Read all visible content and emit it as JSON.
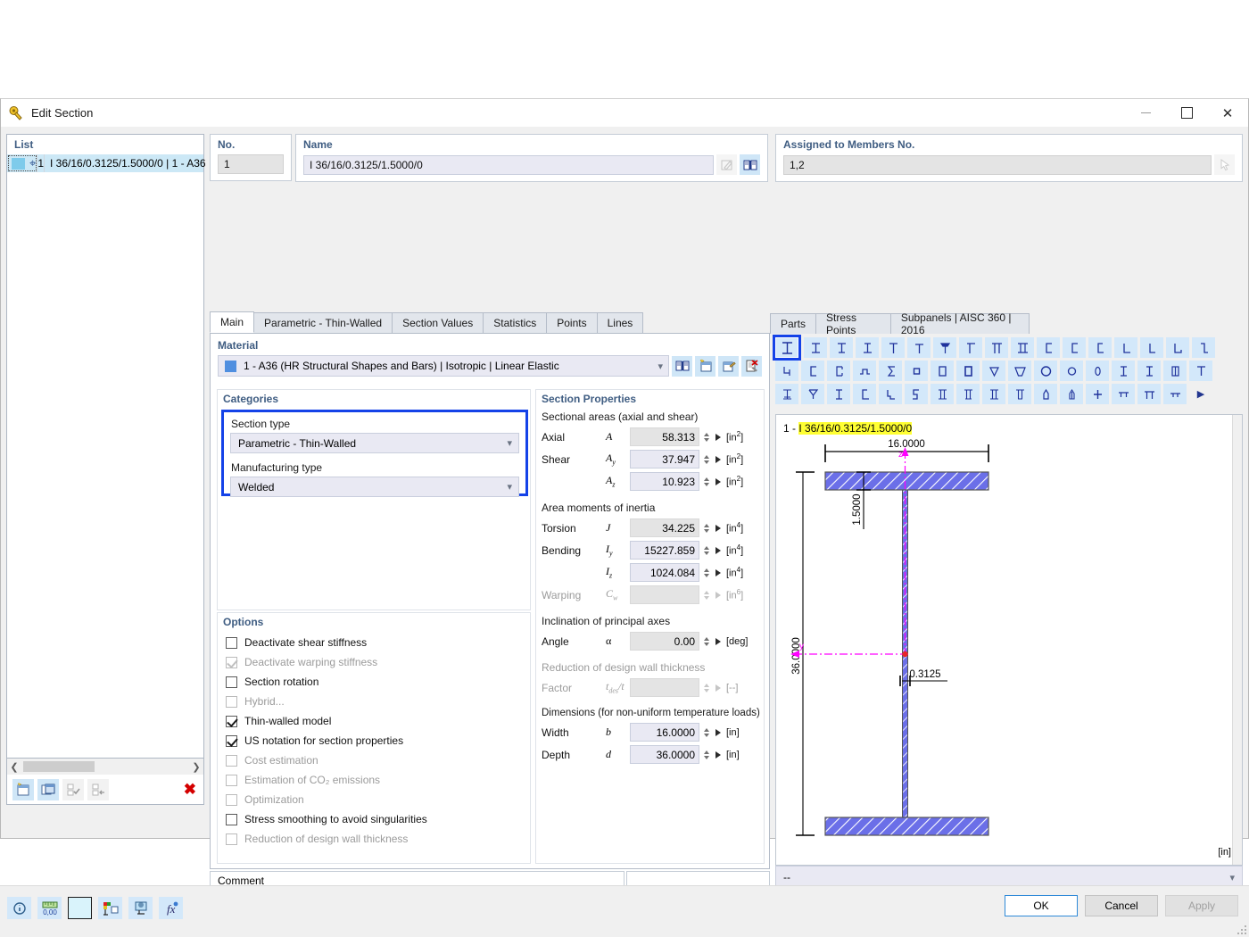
{
  "window": {
    "title": "Edit Section",
    "minimize": "—",
    "maximize": "□",
    "close": "✕"
  },
  "list": {
    "header": "List",
    "rows": [
      {
        "num": "1",
        "label": "I 36/16/0.3125/1.5000/0 | 1 - A36"
      }
    ]
  },
  "no_field": {
    "label": "No.",
    "value": "1"
  },
  "name_field": {
    "label": "Name",
    "value": "I 36/16/0.3125/1.5000/0"
  },
  "assigned": {
    "label": "Assigned to Members No.",
    "value": "1,2"
  },
  "tabs": [
    {
      "label": "Main",
      "active": true
    },
    {
      "label": "Parametric - Thin-Walled",
      "active": false
    },
    {
      "label": "Section Values",
      "active": false
    },
    {
      "label": "Statistics",
      "active": false
    },
    {
      "label": "Points",
      "active": false
    },
    {
      "label": "Lines",
      "active": false
    },
    {
      "label": "Parts",
      "active": false
    },
    {
      "label": "Stress Points",
      "active": false
    },
    {
      "label": "Subpanels | AISC 360 | 2016",
      "active": false
    }
  ],
  "material": {
    "label": "Material",
    "value": "1 - A36 (HR Structural Shapes and Bars) | Isotropic | Linear Elastic",
    "swatch_color": "#4f8fe0"
  },
  "categories": {
    "label": "Categories",
    "section_type_label": "Section type",
    "section_type_value": "Parametric - Thin-Walled",
    "manufacturing_type_label": "Manufacturing type",
    "manufacturing_type_value": "Welded",
    "highlight_color": "#1442e8"
  },
  "options": {
    "label": "Options",
    "items": [
      {
        "label": "Deactivate shear stiffness",
        "checked": false,
        "enabled": true
      },
      {
        "label": "Deactivate warping stiffness",
        "checked": true,
        "enabled": false
      },
      {
        "label": "Section rotation",
        "checked": false,
        "enabled": true
      },
      {
        "label": "Hybrid...",
        "checked": false,
        "enabled": false
      },
      {
        "label": "Thin-walled model",
        "checked": true,
        "enabled": true
      },
      {
        "label": "US notation for section properties",
        "checked": true,
        "enabled": true
      },
      {
        "label": "Cost estimation",
        "checked": false,
        "enabled": false
      },
      {
        "label": "Estimation of CO₂ emissions",
        "checked": false,
        "enabled": false
      },
      {
        "label": "Optimization",
        "checked": false,
        "enabled": false
      },
      {
        "label": "Stress smoothing to avoid singularities",
        "checked": false,
        "enabled": true
      },
      {
        "label": "Reduction of design wall thickness",
        "checked": false,
        "enabled": false
      }
    ]
  },
  "section_properties": {
    "label": "Section Properties",
    "groups": [
      {
        "title": "Sectional areas (axial and shear)",
        "enabled": true,
        "rows": [
          {
            "name": "Axial",
            "symbol": "A",
            "sub": "",
            "value": "58.313",
            "unit": "in",
            "exp": "2",
            "enabled": true,
            "first": true
          },
          {
            "name": "Shear",
            "symbol": "A",
            "sub": "y",
            "value": "37.947",
            "unit": "in",
            "exp": "2",
            "enabled": true
          },
          {
            "name": "",
            "symbol": "A",
            "sub": "z",
            "value": "10.923",
            "unit": "in",
            "exp": "2",
            "enabled": true
          }
        ]
      },
      {
        "title": "Area moments of inertia",
        "enabled": true,
        "rows": [
          {
            "name": "Torsion",
            "symbol": "J",
            "sub": "",
            "value": "34.225",
            "unit": "in",
            "exp": "4",
            "enabled": true,
            "first": true
          },
          {
            "name": "Bending",
            "symbol": "I",
            "sub": "y",
            "value": "15227.859",
            "unit": "in",
            "exp": "4",
            "enabled": true
          },
          {
            "name": "",
            "symbol": "I",
            "sub": "z",
            "value": "1024.084",
            "unit": "in",
            "exp": "4",
            "enabled": true
          },
          {
            "name": "Warping",
            "symbol": "C",
            "sub": "w",
            "value": "",
            "unit": "in",
            "exp": "6",
            "enabled": false
          }
        ]
      },
      {
        "title": "Inclination of principal axes",
        "enabled": true,
        "rows": [
          {
            "name": "Angle",
            "symbol": "α",
            "sub": "",
            "value": "0.00",
            "unit": "deg",
            "exp": "",
            "enabled": true,
            "first": true
          }
        ]
      },
      {
        "title": "Reduction of design wall thickness",
        "enabled": false,
        "rows": [
          {
            "name": "Factor",
            "symbol": "t",
            "sub": "des/t",
            "value": "",
            "unit": "--",
            "exp": "",
            "enabled": false
          }
        ]
      },
      {
        "title": "Dimensions (for non-uniform temperature loads)",
        "enabled": true,
        "rows": [
          {
            "name": "Width",
            "symbol": "b",
            "sub": "",
            "value": "16.0000",
            "unit": "in",
            "exp": "",
            "enabled": true
          },
          {
            "name": "Depth",
            "symbol": "d",
            "sub": "",
            "value": "36.0000",
            "unit": "in",
            "exp": "",
            "enabled": true
          }
        ]
      }
    ]
  },
  "comment": {
    "label": "Comment",
    "value": ""
  },
  "shape_palette": {
    "rows": [
      [
        "⌶",
        "⌶",
        "⌶",
        "⌶",
        "⊤",
        "⊤",
        "⊤",
        "⊤",
        "π",
        "⌶",
        "⊂",
        "⊂",
        "⊂",
        "└",
        "└",
        "└",
        "┐"
      ],
      [
        "┐",
        "⊂",
        "⊂",
        "∩",
        "Σ",
        "□",
        "□",
        "□",
        "▽",
        "▽",
        "○",
        "○",
        "0",
        "⌶",
        "⌶",
        "□",
        "⊤"
      ],
      [
        "⌶",
        "⌶",
        "⌶",
        "⊂",
        "⊂",
        "⊂",
        "⌶",
        "⌶",
        "⌶",
        "⌶",
        "△",
        "△",
        "+",
        "⊤",
        "⊤",
        "⊤",
        "▶"
      ]
    ],
    "selected_index": 0,
    "selected_color": "#1442e8"
  },
  "drawing": {
    "caption_prefix": "1 - ",
    "caption_highlight": "I 36/16/0.3125/1.5000/0",
    "unit": "[in]",
    "dim_width": "16.0000",
    "dim_depth": "36.0000",
    "dim_flange_thickness": "1.5000",
    "dim_web_thickness": "0.3125",
    "shape_fill": "#6b6fe8",
    "centroid_color": "#ff00ff"
  },
  "bottom_status_select": {
    "value": "--"
  },
  "dialog_buttons": {
    "ok": "OK",
    "cancel": "Cancel",
    "apply": "Apply"
  }
}
